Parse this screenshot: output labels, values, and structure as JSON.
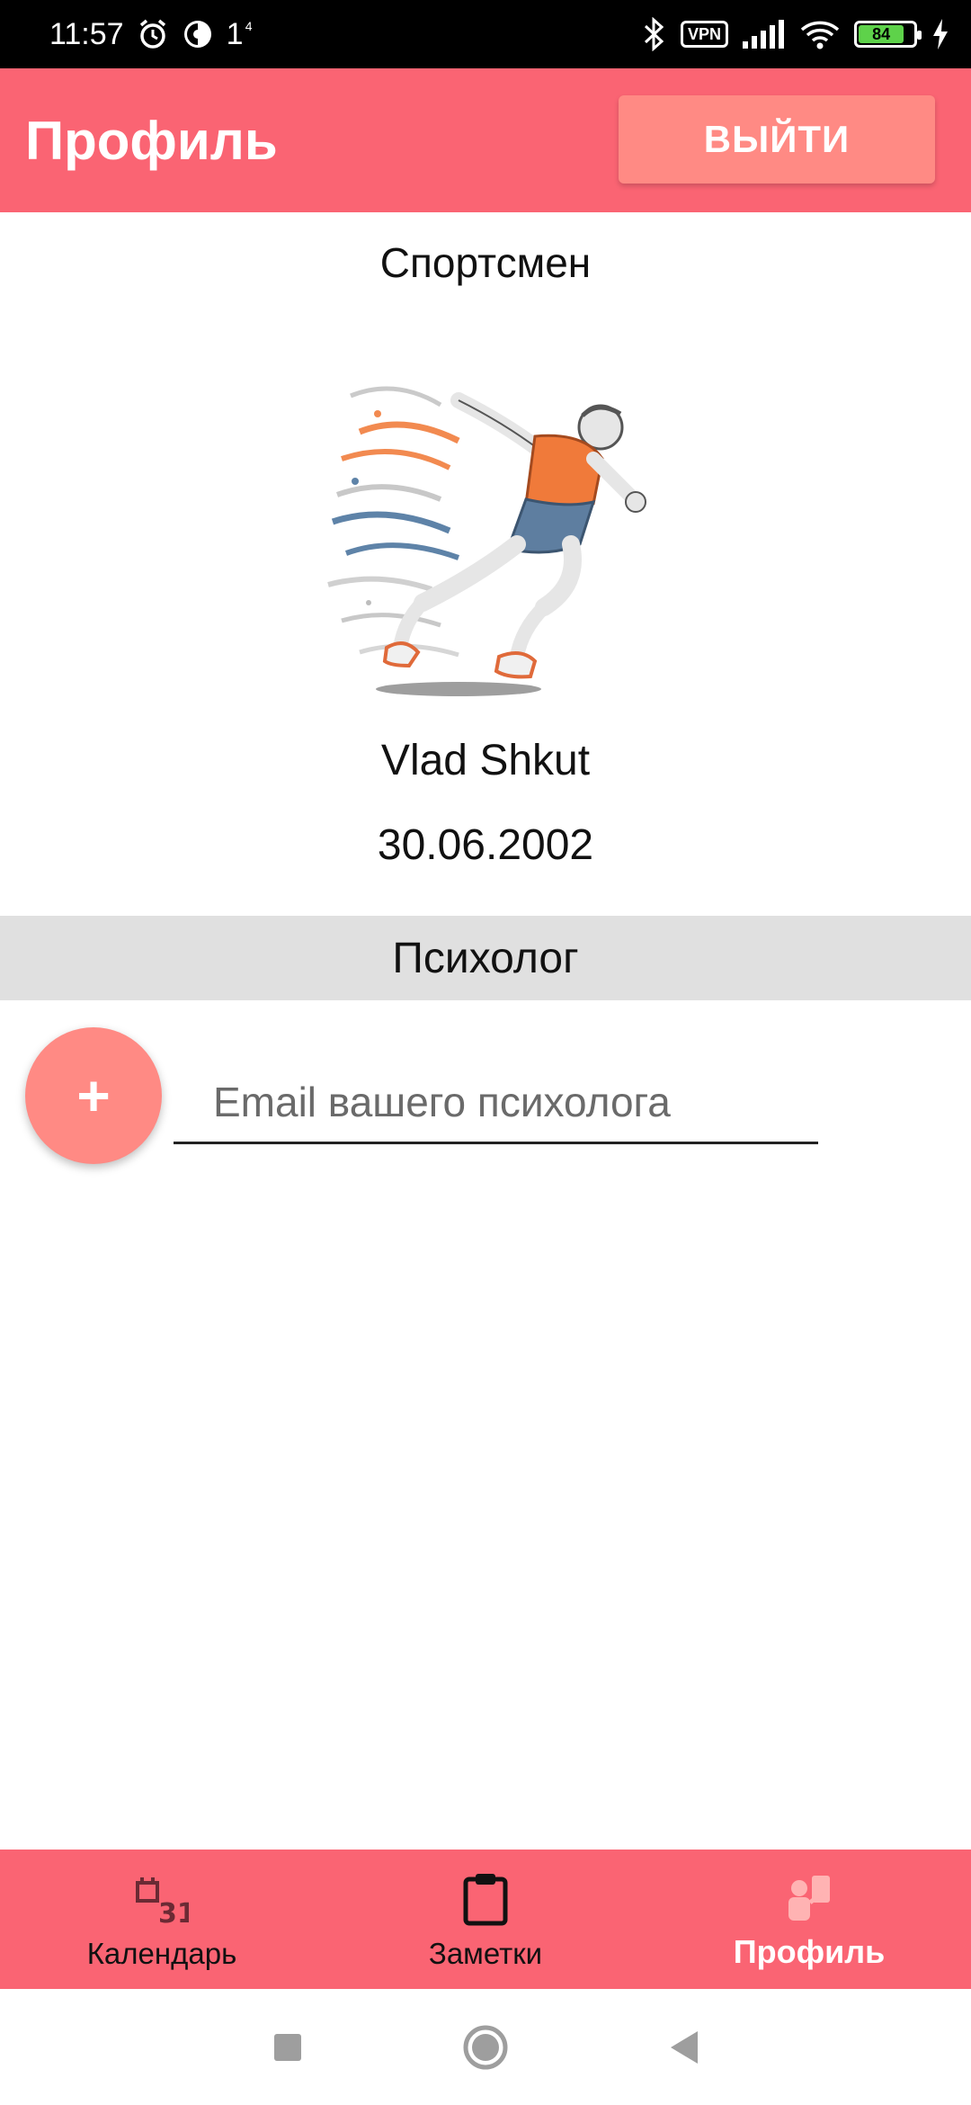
{
  "status_bar": {
    "time": "11:57",
    "notification_count": "1",
    "vpn_label": "VPN",
    "battery_level": "84",
    "icons": [
      "alarm-icon",
      "notification-app-icon",
      "bluetooth-icon",
      "signal-icon",
      "wifi-icon",
      "battery-icon",
      "charging-icon"
    ]
  },
  "app_bar": {
    "title": "Профиль",
    "logout_label": "ВЫЙТИ"
  },
  "profile": {
    "role": "Спортсмен",
    "name": "Vlad Shkut",
    "birth_date": "30.06.2002",
    "avatar_icon": "runner-illustration"
  },
  "psychologist": {
    "section_title": "Психолог",
    "add_button_label": "+",
    "email_placeholder": "Email вашего психолога",
    "email_value": ""
  },
  "bottom_nav": {
    "items": [
      {
        "label": "Календарь",
        "icon": "calendar-icon",
        "active": false
      },
      {
        "label": "Заметки",
        "icon": "clipboard-icon",
        "active": false
      },
      {
        "label": "Профиль",
        "icon": "profile-icon",
        "active": true
      }
    ]
  },
  "colors": {
    "accent": "#fa6473",
    "button": "#ff8a84",
    "section_bg": "#e0e0e0",
    "active_icon": "#ffb3b3"
  }
}
